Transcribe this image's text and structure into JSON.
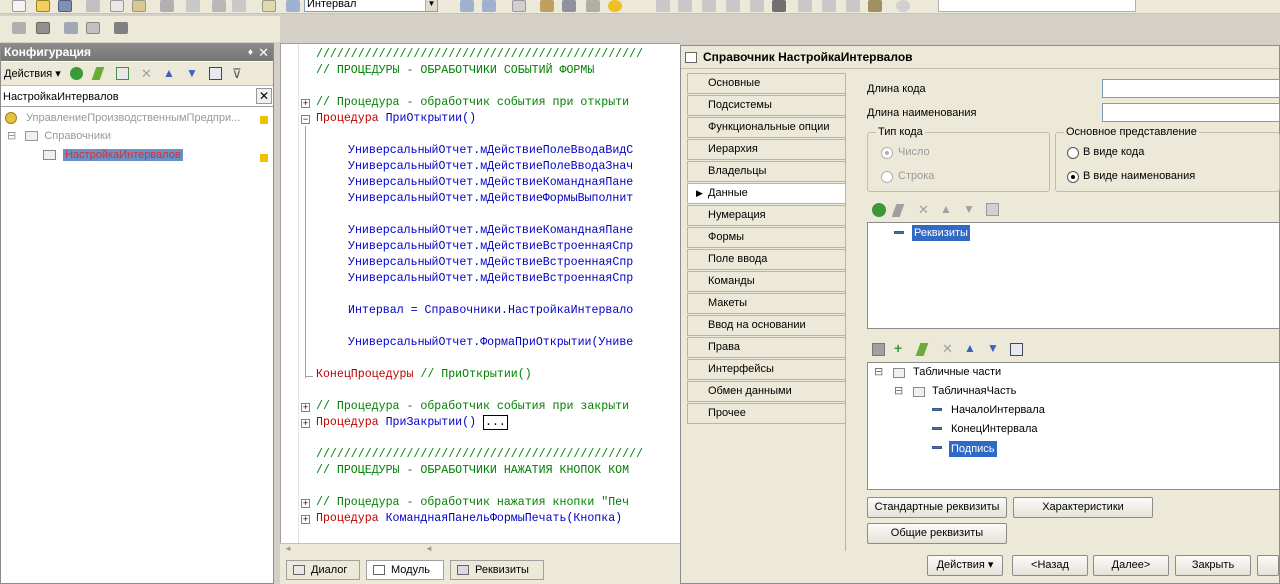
{
  "toolbar": {
    "search_value": "Интервал"
  },
  "left_panel": {
    "title": "Конфигурация",
    "actions_label": "Действия",
    "filter_value": "НастройкаИнтервалов",
    "tree": {
      "root": "УправлениеПроизводственнымПредпри...",
      "catalogs": "Справочники",
      "item": "НастройкаИнтервалов"
    }
  },
  "editor": {
    "lines": [
      "///////////////////////////////////////////////",
      "// ПРОЦЕДУРЫ - ОБРАБОТЧИКИ СОБЫТИЙ ФОРМЫ",
      "// Процедура - обработчик события при открыти",
      "Процедура ",
      "ПриОткрытии()",
      "УниверсальныйОтчет.мДействиеПолеВводаВидС",
      "УниверсальныйОтчет.мДействиеПолеВводаЗнач",
      "УниверсальныйОтчет.мДействиеКоманднаяПане",
      "УниверсальныйОтчет.мДействиеФормыВыполнит",
      "УниверсальныйОтчет.мДействиеКоманднаяПане",
      "УниверсальныйОтчет.мДействиеВстроеннаяСпр",
      "УниверсальныйОтчет.мДействиеВстроеннаяСпр",
      "УниверсальныйОтчет.мДействиеВстроеннаяСпр",
      "Интервал = Справочники.НастройкаИнтервало",
      "УниверсальныйОтчет.ФормаПриОткрытии(Униве",
      "КонецПроцедуры",
      " // ПриОткрытии()",
      "// Процедура - обработчик события при закрыти",
      "Процедура ",
      "ПриЗакрытии()",
      "...",
      "///////////////////////////////////////////////",
      "// ПРОЦЕДУРЫ - ОБРАБОТЧИКИ НАЖАТИЯ КНОПОК КОМ",
      "// Процедура - обработчик нажатия кнопки \"Печ",
      "Процедура ",
      "КоманднаяПанельФормыПечать(Кнопка)"
    ]
  },
  "bottom_tabs": [
    "Диалог",
    "Модуль",
    "Реквизиты"
  ],
  "dialog": {
    "title": "Справочник НастройкаИнтервалов",
    "tabs": [
      "Основные",
      "Подсистемы",
      "Функциональные опции",
      "Иерархия",
      "Владельцы",
      "Данные",
      "Нумерация",
      "Формы",
      "Поле ввода",
      "Команды",
      "Макеты",
      "Ввод на основании",
      "Права",
      "Интерфейсы",
      "Обмен данными",
      "Прочее"
    ],
    "code_length_label": "Длина кода",
    "name_length_label": "Длина наименования",
    "code_type": {
      "legend": "Тип кода",
      "number": "Число",
      "string": "Строка"
    },
    "main_repr": {
      "legend": "Основное представление",
      "as_code": "В виде кода",
      "as_name": "В виде наименования"
    },
    "attributes_root": "Реквизиты",
    "tabular": {
      "root": "Табличные части",
      "part": "ТабличнаяЧасть",
      "attrs": [
        "НачалоИнтервала",
        "КонецИнтервала",
        "Подпись"
      ]
    },
    "buttons": {
      "standard_attrs": "Стандартные реквизиты",
      "characteristics": "Характеристики",
      "common_attrs": "Общие реквизиты"
    },
    "footer": {
      "actions": "Действия",
      "back": "<Назад",
      "next": "Далее>",
      "close": "Закрыть"
    }
  }
}
